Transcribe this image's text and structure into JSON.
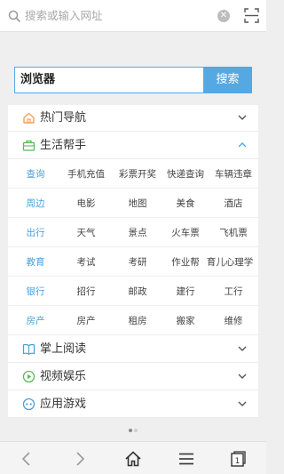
{
  "address_bar": {
    "placeholder": "搜索或输入网址"
  },
  "search": {
    "value": "浏览器",
    "button_label": "搜索"
  },
  "sections": {
    "hot_nav": "热门导航",
    "life_helper": "生活帮手",
    "reading": "掌上阅读",
    "video": "视频娱乐",
    "games": "应用游戏"
  },
  "life_helper_grid": [
    {
      "category": "查询",
      "items": [
        "手机充值",
        "彩票开奖",
        "快递查询",
        "车辆违章"
      ]
    },
    {
      "category": "周边",
      "items": [
        "电影",
        "地图",
        "美食",
        "酒店"
      ]
    },
    {
      "category": "出行",
      "items": [
        "天气",
        "景点",
        "火车票",
        "飞机票"
      ]
    },
    {
      "category": "教育",
      "items": [
        "考试",
        "考研",
        "作业帮",
        "育儿心理学"
      ]
    },
    {
      "category": "银行",
      "items": [
        "招行",
        "邮政",
        "建行",
        "工行"
      ]
    },
    {
      "category": "房产",
      "items": [
        "房产",
        "租房",
        "搬家",
        "维修"
      ]
    }
  ],
  "colors": {
    "accent": "#56a8e3",
    "category_text": "#4a9fd8",
    "icon_orange": "#f0a05a",
    "icon_green": "#5cb85c"
  },
  "icons": {
    "top_search": "search-icon",
    "clear": "clear-icon",
    "scan": "scan-icon",
    "back": "back-icon",
    "forward": "forward-icon",
    "home": "home-icon",
    "menu": "menu-icon",
    "tabs": "tabs-icon"
  },
  "tabs_count": "1"
}
